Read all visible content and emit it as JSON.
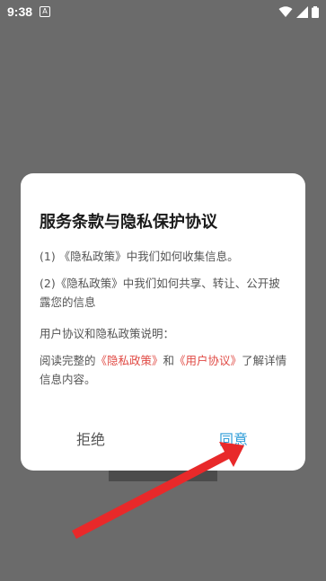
{
  "status_bar": {
    "time": "9:38",
    "notification_icon": "a-notification-icon",
    "icons": [
      "wifi-icon",
      "signal-icon",
      "battery-icon"
    ]
  },
  "dialog": {
    "title": "服务条款与隐私保护协议",
    "item1": "(1) 《隐私政策》中我们如何收集信息。",
    "item2": "(2)《隐私政策》中我们如何共享、转让、公开披露您的信息",
    "explain_heading": "用户协议和隐私政策说明：",
    "read_prefix": "阅读完整的",
    "privacy_link": "《隐私政策》",
    "and_text": "和",
    "user_link": "《用户协议》",
    "read_suffix": "了解详情信息内容。",
    "decline_label": "拒绝",
    "agree_label": "同意"
  },
  "colors": {
    "accent": "#2e9cd8",
    "link": "#e04a44",
    "arrow": "#e8292a"
  }
}
